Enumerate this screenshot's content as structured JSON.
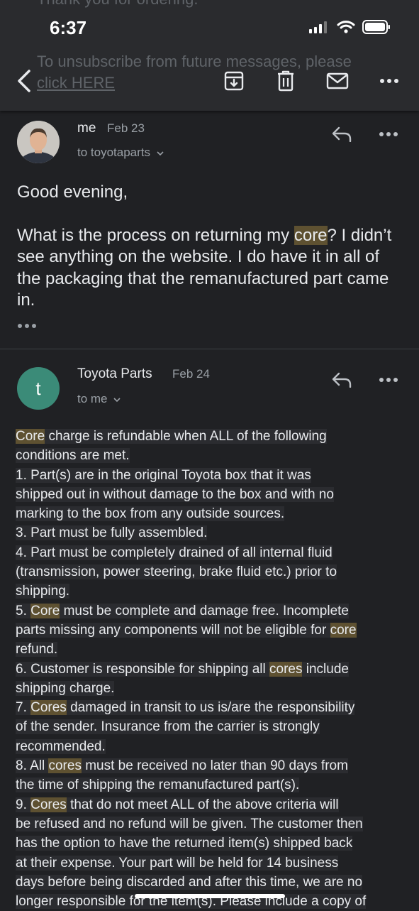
{
  "status_bar": {
    "time": "6:37"
  },
  "background_text": {
    "line1": "Thank you for ordering.",
    "line2": "To unsubscribe from future messages, please",
    "line3": "click HERE"
  },
  "toolbar": {
    "back_icon": "back-arrow-icon",
    "archive_icon": "archive-icon",
    "delete_icon": "trash-icon",
    "mark_unread_icon": "mail-icon",
    "more_icon": "more-icon"
  },
  "messages": [
    {
      "sender": "me",
      "date": "Feb 23",
      "recipient": "to toyotaparts",
      "greeting": "Good evening,",
      "body_pre": "What is the process on returning my ",
      "body_hl": "core",
      "body_post": "? I didn’t see anything on the website. I do have it in all of the packaging that the remanufactured part came in."
    },
    {
      "sender": "Toyota Parts",
      "avatar_letter": "t",
      "date": "Feb 24",
      "recipient": "to me",
      "lines": [
        [
          {
            "t": "Core",
            "h": true
          },
          {
            "t": " charge is refundable  when ALL of the following"
          }
        ],
        [
          {
            "t": "conditions are met. "
          }
        ],
        [
          {
            "t": " 1. Part(s) are in the original Toyota box that it was"
          }
        ],
        [
          {
            "t": "shipped out in without damage to the box and with no"
          }
        ],
        [
          {
            "t": "marking to the box from any outside sources. "
          }
        ],
        [
          {
            "t": " 3. Part must be fully assembled. "
          }
        ],
        [
          {
            "t": " 4. Part must be completely drained of all internal fluid"
          }
        ],
        [
          {
            "t": "(transmission, power steering, brake fluid etc.) prior to"
          }
        ],
        [
          {
            "t": "shipping. "
          }
        ],
        [
          {
            "t": " 5. "
          },
          {
            "t": "Core",
            "h": true
          },
          {
            "t": " must be complete and damage free. Incomplete"
          }
        ],
        [
          {
            "t": "parts missing any components will not be eligible for "
          },
          {
            "t": "core",
            "h": true
          }
        ],
        [
          {
            "t": "refund. "
          }
        ],
        [
          {
            "t": " 6. Customer is responsible for shipping all "
          },
          {
            "t": "cores",
            "h": true
          },
          {
            "t": " include"
          }
        ],
        [
          {
            "t": "shipping charge. "
          }
        ],
        [
          {
            "t": " 7. "
          },
          {
            "t": "Cores",
            "h": true
          },
          {
            "t": " damaged in transit to us is/are the responsibility"
          }
        ],
        [
          {
            "t": "of the sender. Insurance from the carrier is strongly"
          }
        ],
        [
          {
            "t": "recommended. "
          }
        ],
        [
          {
            "t": " 8. All "
          },
          {
            "t": "cores",
            "h": true
          },
          {
            "t": " must be received no later than 90 days from"
          }
        ],
        [
          {
            "t": "the time of shipping the remanufactured part(s). "
          }
        ],
        [
          {
            "t": " 9. "
          },
          {
            "t": "Cores",
            "h": true
          },
          {
            "t": " that do not meet ALL of the above criteria will"
          }
        ],
        [
          {
            "t": "be refused and no refund will be given. The customer then"
          }
        ],
        [
          {
            "t": "has the option to have the returned item(s) shipped back"
          }
        ],
        [
          {
            "t": "at their expense. Your part will be held for 14 business"
          }
        ],
        [
          {
            "t": "days before being discarded and after this time, we are no"
          }
        ],
        [
          {
            "t": "longer responsible for the item(s). Please include a copy of"
          }
        ]
      ]
    }
  ],
  "colors": {
    "background": "#202124",
    "highlight": "#5e5131",
    "avatar_teal": "#3b8b78"
  }
}
